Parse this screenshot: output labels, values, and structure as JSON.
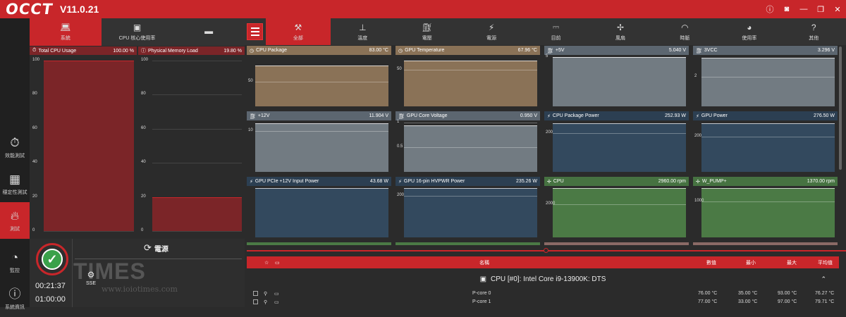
{
  "app": {
    "logo": "OCCT",
    "version": "V11.0.21"
  },
  "window_controls": [
    "info-icon",
    "camera-icon",
    "minimize-icon",
    "restore-icon",
    "close-icon"
  ],
  "sidebar": {
    "items": [
      {
        "label": "效能測試",
        "icon": "stopwatch-icon"
      },
      {
        "label": "穩定性測試",
        "icon": "stability-icon"
      },
      {
        "label": "測試",
        "icon": "flame-icon",
        "active": true
      },
      {
        "label": "監控",
        "icon": "gauge-icon"
      },
      {
        "label": "系統資訊",
        "icon": "info-icon"
      }
    ]
  },
  "left_tabs": [
    {
      "label": "系統",
      "icon": "laptop-icon",
      "active": true
    },
    {
      "label": "CPU 核心使用率",
      "icon": "cpu-icon"
    },
    {
      "label": "",
      "icon": "gpu-icon"
    }
  ],
  "cpu_usage": {
    "label": "Total CPU Usage",
    "value": "100.00 %",
    "level": 1.0,
    "ticks": [
      "100",
      "80",
      "60",
      "40",
      "20",
      "0"
    ]
  },
  "memory_load": {
    "label": "Physical Memory Load",
    "value": "19.80 %",
    "level": 0.198,
    "ticks": [
      "100",
      "80",
      "60",
      "40",
      "20",
      "0"
    ]
  },
  "power_test": {
    "title": "電源",
    "elapsed": "00:21:37",
    "duration": "01:00:00",
    "instruction": "SSE",
    "status": "running"
  },
  "monitor_tabs": [
    {
      "label": "全部",
      "icon": "wrench-icon",
      "active": true
    },
    {
      "label": "溫度",
      "icon": "thermometer-icon"
    },
    {
      "label": "電壓",
      "icon": "fuel-icon"
    },
    {
      "label": "電源",
      "icon": "plug-icon"
    },
    {
      "label": "目前",
      "icon": "current-icon"
    },
    {
      "label": "風扇",
      "icon": "fan-icon"
    },
    {
      "label": "時脈",
      "icon": "speedometer-icon"
    },
    {
      "label": "使用率",
      "icon": "usage-gauge-icon"
    },
    {
      "label": "其他",
      "icon": "question-icon"
    }
  ],
  "graphs": [
    {
      "label": "CPU Package",
      "value": "83.00 °C",
      "color": "#8a7257",
      "head": "#8a7257",
      "ticks": [
        {
          "t": "50",
          "y": 0.5
        }
      ],
      "level": 0.83,
      "icon": "clock-icon"
    },
    {
      "label": "GPU Temperature",
      "value": "67.96 °C",
      "color": "#8a7257",
      "head": "#8a7257",
      "ticks": [
        {
          "t": "50",
          "y": 0.75
        }
      ],
      "level": 0.93,
      "icon": "clock-icon"
    },
    {
      "label": "+5V",
      "value": "5.040 V",
      "color": "#727b82",
      "head": "#5c6670",
      "ticks": [
        {
          "t": "5",
          "y": 1.0
        }
      ],
      "level": 1.0,
      "icon": "fuel-icon"
    },
    {
      "label": "3VCC",
      "value": "3.296 V",
      "color": "#727b82",
      "head": "#5c6670",
      "ticks": [
        {
          "t": "2",
          "y": 0.6
        }
      ],
      "level": 0.99,
      "icon": "fuel-icon"
    },
    {
      "label": "+12V",
      "value": "11.904 V",
      "color": "#727b82",
      "head": "#5c6670",
      "ticks": [
        {
          "t": "10",
          "y": 0.83
        }
      ],
      "level": 0.99,
      "icon": "fuel-icon"
    },
    {
      "label": "GPU Core Voltage",
      "value": "0.950 V",
      "color": "#727b82",
      "head": "#5c6670",
      "ticks": [
        {
          "t": "1",
          "y": 1.0
        },
        {
          "t": "0.5",
          "y": 0.5
        }
      ],
      "level": 0.95,
      "icon": "fuel-icon"
    },
    {
      "label": "CPU Package Power",
      "value": "252.93 W",
      "color": "#33495e",
      "head": "#2c3f52",
      "ticks": [
        {
          "t": "200",
          "y": 0.78
        }
      ],
      "level": 0.98,
      "icon": "plug-icon"
    },
    {
      "label": "GPU Power",
      "value": "276.50 W",
      "color": "#33495e",
      "head": "#2c3f52",
      "ticks": [
        {
          "t": "200",
          "y": 0.72
        }
      ],
      "level": 0.99,
      "icon": "plug-icon"
    },
    {
      "label": "GPU PCIe +12V Input Power",
      "value": "43.68 W",
      "color": "#33495e",
      "head": "#2c3f52",
      "ticks": [],
      "level": 1.0,
      "icon": "plug-icon"
    },
    {
      "label": "GPU 16-pin HVPWR Power",
      "value": "235.26 W",
      "color": "#33495e",
      "head": "#2c3f52",
      "ticks": [
        {
          "t": "200",
          "y": 0.85
        }
      ],
      "level": 1.0,
      "icon": "plug-icon"
    },
    {
      "label": "CPU",
      "value": "2960.00 rpm",
      "color": "#4b7a45",
      "head": "#467241",
      "ticks": [
        {
          "t": "2000",
          "y": 0.67
        }
      ],
      "level": 1.0,
      "icon": "fan-icon"
    },
    {
      "label": "W_PUMP+",
      "value": "1370.00 rpm",
      "color": "#4b7a45",
      "head": "#467241",
      "ticks": [
        {
          "t": "1000",
          "y": 0.73
        }
      ],
      "level": 1.0,
      "icon": "fan-icon"
    }
  ],
  "table": {
    "columns": [
      "名稱",
      "數值",
      "最小",
      "最大",
      "平均值"
    ],
    "group_title": "CPU [#0]: Intel Core i9-13900K: DTS",
    "rows": [
      {
        "name": "P-core 0",
        "value": "76.00 °C",
        "min": "35.00 °C",
        "max": "93.00 °C",
        "avg": "76.27 °C"
      },
      {
        "name": "P-core 1",
        "value": "77.00 °C",
        "min": "33.00 °C",
        "max": "97.00 °C",
        "avg": "79.71 °C"
      }
    ]
  },
  "watermark": {
    "line1": "TIMES",
    "line2": "www.ioiotimes.com"
  }
}
